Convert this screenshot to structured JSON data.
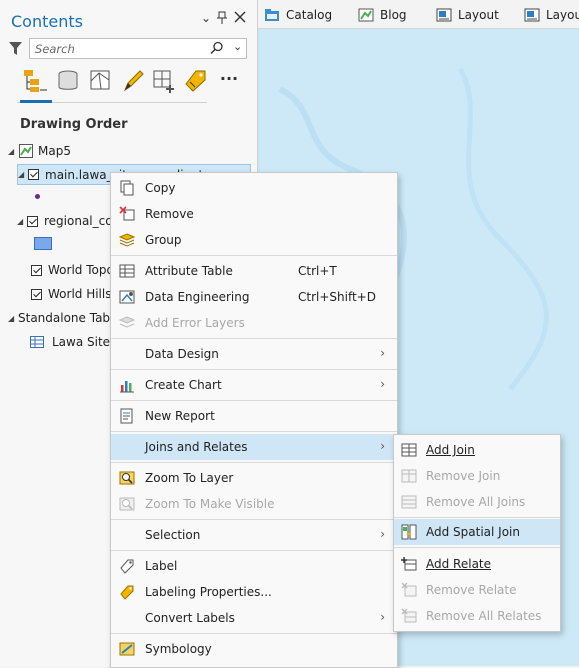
{
  "contents": {
    "title": "Contents",
    "search_placeholder": "Search",
    "heading": "Drawing Order",
    "tree": {
      "map": "Map5",
      "layer1": "main.lawa_sites_coordinates",
      "layer2": "regional_council",
      "layer3": "World Topographic Map",
      "layer4": "World Hillshade",
      "standalone": "Standalone Tables",
      "table1": "Lawa Sites"
    }
  },
  "map_tabs": [
    "Catalog",
    "Blog",
    "Layout",
    "Layout"
  ],
  "context_menu": {
    "copy": "Copy",
    "remove": "Remove",
    "group": "Group",
    "attribute_table": "Attribute Table",
    "attribute_table_shortcut": "Ctrl+T",
    "data_engineering": "Data Engineering",
    "data_engineering_shortcut": "Ctrl+Shift+D",
    "add_error_layers": "Add Error Layers",
    "data_design": "Data Design",
    "create_chart": "Create Chart",
    "new_report": "New Report",
    "joins_and_relates": "Joins and Relates",
    "zoom_to_layer": "Zoom To Layer",
    "zoom_to_visible": "Zoom To Make Visible",
    "selection": "Selection",
    "label": "Label",
    "labeling_properties": "Labeling Properties...",
    "convert_labels": "Convert Labels",
    "symbology": "Symbology"
  },
  "submenu": {
    "add_join": "Add Join",
    "remove_join": "Remove Join",
    "remove_all_joins": "Remove All Joins",
    "add_spatial_join": "Add Spatial Join",
    "add_relate": "Add Relate",
    "remove_relate": "Remove Relate",
    "remove_all_relates": "Remove All Relates"
  },
  "colors": {
    "accent": "#1a6fb4",
    "highlight": "#cfe6f7",
    "map_water": "#cde9f8"
  }
}
